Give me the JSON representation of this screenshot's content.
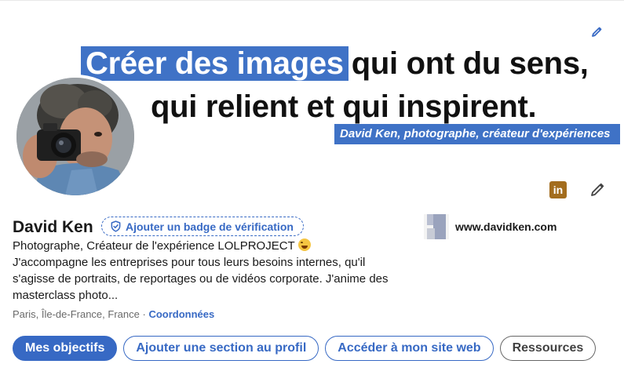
{
  "banner": {
    "highlight_text": "Créer des images",
    "line1_rest": "qui ont du sens,",
    "line2": "qui relient et qui inspirent.",
    "tagline": "David Ken, photographe, créateur d'expériences",
    "accent_color": "#3f72c6",
    "edit_icon": "pencil-icon"
  },
  "profile": {
    "name": "David Ken",
    "verify_badge_label": "Ajouter un badge de vérification",
    "verify_icon": "shield-check-icon",
    "headline": "Photographe, Créateur de l'expérience LOLPROJECT",
    "about": "J'accompagne les entreprises pour tous leurs besoins internes, qu'il s'agisse de portraits, de reportages ou de vidéos corporate. J'anime des masterclass photo...",
    "location": "Paris, Île-de-France, France",
    "location_separator": "·",
    "contact_link": "Coordonnées",
    "emoji": "laughing-emoji"
  },
  "website": {
    "label": "www.davidken.com"
  },
  "icons": {
    "linkedin": "in",
    "linkedin_color": "#a36d1e",
    "edit": "pencil-icon"
  },
  "actions": [
    {
      "label": "Mes objectifs",
      "style": "primary"
    },
    {
      "label": "Ajouter une section au profil",
      "style": "outline"
    },
    {
      "label": "Accéder à mon site web",
      "style": "outline"
    },
    {
      "label": "Ressources",
      "style": "neutral"
    }
  ],
  "colors": {
    "link_blue": "#3769c4",
    "banner_blue": "#3f72c6"
  }
}
